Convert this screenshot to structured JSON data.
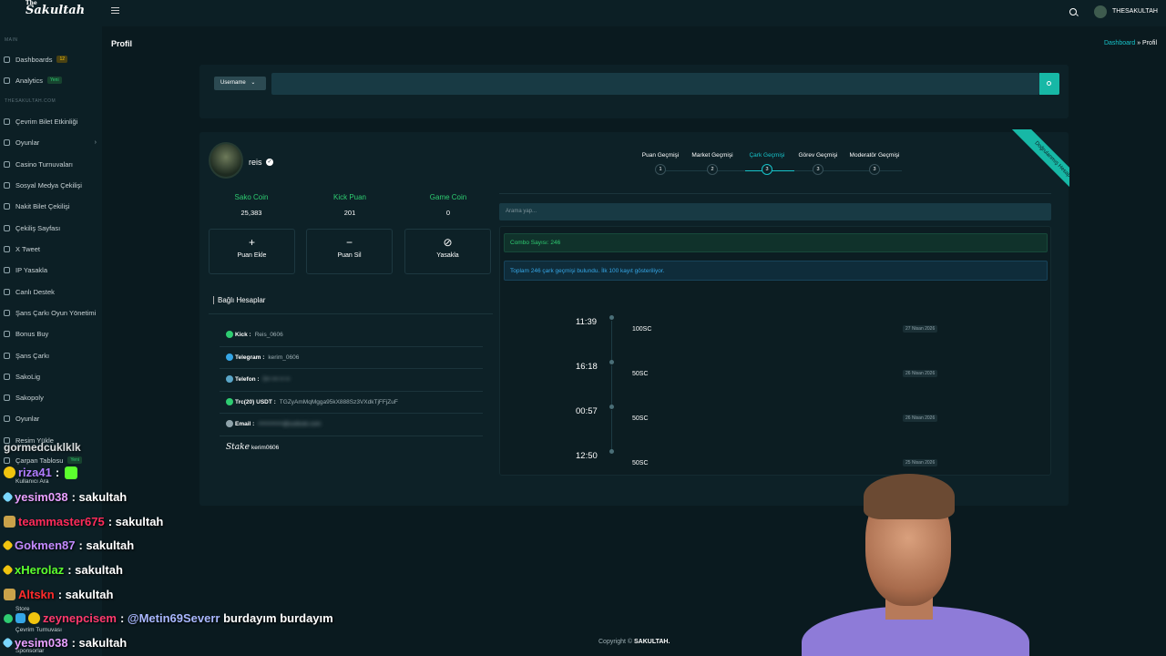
{
  "app": {
    "logo": "Sakultah",
    "logo_small": "The",
    "user": "THESAKULTAH"
  },
  "sidebar": {
    "section_main": "MAIN",
    "section_site": "THESAKULTAH.COM",
    "items": [
      {
        "label": "Dashboards",
        "badge": "12"
      },
      {
        "label": "Analytics",
        "badge": "Yeni"
      },
      {
        "label": "Çevrim Bilet Etkinliği"
      },
      {
        "label": "Oyunlar"
      },
      {
        "label": "Casino Turnuvaları"
      },
      {
        "label": "Sosyal Medya Çekilişi"
      },
      {
        "label": "Nakit Bilet Çekilişi"
      },
      {
        "label": "Çekiliş Sayfası"
      },
      {
        "label": "X Tweet"
      },
      {
        "label": "IP Yasakla"
      },
      {
        "label": "Canlı Destek"
      },
      {
        "label": "Şans Çarkı Oyun Yönetimi"
      },
      {
        "label": "Bonus Buy"
      },
      {
        "label": "Şans Çarkı"
      },
      {
        "label": "SakoLig"
      },
      {
        "label": "Sakopoly"
      },
      {
        "label": "Oyunlar"
      },
      {
        "label": "Resim Yükle"
      },
      {
        "label": "Çarpan Tablosu",
        "badge": "Yeni"
      }
    ],
    "faint_items": [
      "Kullanıcı Ara",
      "Store",
      "Çevrim Turnuvası",
      "Sponsorlar"
    ]
  },
  "page": {
    "title": "Profil",
    "breadcrumb_home": "Dashboard",
    "breadcrumb_sep": "»",
    "breadcrumb_current": "Profil"
  },
  "search": {
    "select_label": "Username"
  },
  "profile": {
    "name": "reis",
    "stats": [
      {
        "label": "Sako Coin",
        "value": "25,383"
      },
      {
        "label": "Kick Puan",
        "value": "201"
      },
      {
        "label": "Game Coin",
        "value": "0"
      }
    ],
    "actions": [
      {
        "icon": "+",
        "label": "Puan Ekle"
      },
      {
        "icon": "−",
        "label": "Puan Sil"
      },
      {
        "icon": "⊘",
        "label": "Yasakla"
      }
    ],
    "linked_title": "Bağlı Hesaplar",
    "accounts": [
      {
        "label": "Kick :",
        "value": "Reis_0606",
        "color": "#2ecc71"
      },
      {
        "label": "Telegram :",
        "value": "kerim_0606",
        "color": "#35a6e6"
      },
      {
        "label": "Telefon :",
        "value": "5•• ••• •• ••",
        "color": "#5aa6c8"
      },
      {
        "label": "Trc(20) USDT :",
        "value": "TGZyAmMqMgga95kX888Sz3VXdkTjFFjZuF",
        "color": "#2ecc71"
      },
      {
        "label": "Email :",
        "value": "••••••••••••@outlook.com",
        "color": "#8fa3aa"
      },
      {
        "label": "Stake",
        "value": "kerim0606",
        "color": "#ffffff"
      }
    ]
  },
  "tabs": [
    {
      "label": "Puan Geçmişi",
      "count": "1"
    },
    {
      "label": "Market Geçmişi",
      "count": "2"
    },
    {
      "label": "Çark Geçmişi",
      "count": "3"
    },
    {
      "label": "Görev Geçmişi",
      "count": "3"
    },
    {
      "label": "Moderatör Geçmişi",
      "count": "3"
    }
  ],
  "ribbon": "Doğrulanmış Hesap",
  "history": {
    "filter_placeholder": "Arama yap...",
    "combo": "Combo Sayısı: 246",
    "info": "Toplam 246 çark geçmişi bulundu. İlk 100 kayıt gösteriliyor.",
    "entries": [
      {
        "time": "11:39",
        "amount": "100SC",
        "date": "27 Nisan 2026"
      },
      {
        "time": "16:18",
        "amount": "50SC",
        "date": "26 Nisan 2026"
      },
      {
        "time": "00:57",
        "amount": "50SC",
        "date": "26 Nisan 2026"
      },
      {
        "time": "12:50",
        "amount": "50SC",
        "date": "25 Nisan 2026"
      }
    ]
  },
  "footer": {
    "prefix": "Copyright ©",
    "brand": "SAKULTAH."
  },
  "chat": [
    {
      "user": "gormedcuklklk",
      "message": "",
      "color": "#ffffff"
    },
    {
      "user": "riza41",
      "message": ":",
      "color": "#b07cff"
    },
    {
      "user": "yesim038",
      "message": ": sakultah",
      "color": "#e9a0ff"
    },
    {
      "user": "teammaster675",
      "message": ": sakultah",
      "color": "#ff2b5a"
    },
    {
      "user": "Gokmen87",
      "message": ": sakultah",
      "color": "#c48aff"
    },
    {
      "user": "xHerolaz",
      "message": ": sakultah",
      "color": "#5cff2e"
    },
    {
      "user": "Altskn",
      "message": ": sakultah",
      "color": "#ff2b2b"
    },
    {
      "user": "zeynepcisem",
      "message": ": @Metin69Severr burdayım burdayım",
      "color": "#ff3a6e",
      "mention": "@Metin69Severr"
    },
    {
      "user": "yesim038",
      "message": ": sakultah",
      "color": "#e9a0ff"
    }
  ]
}
